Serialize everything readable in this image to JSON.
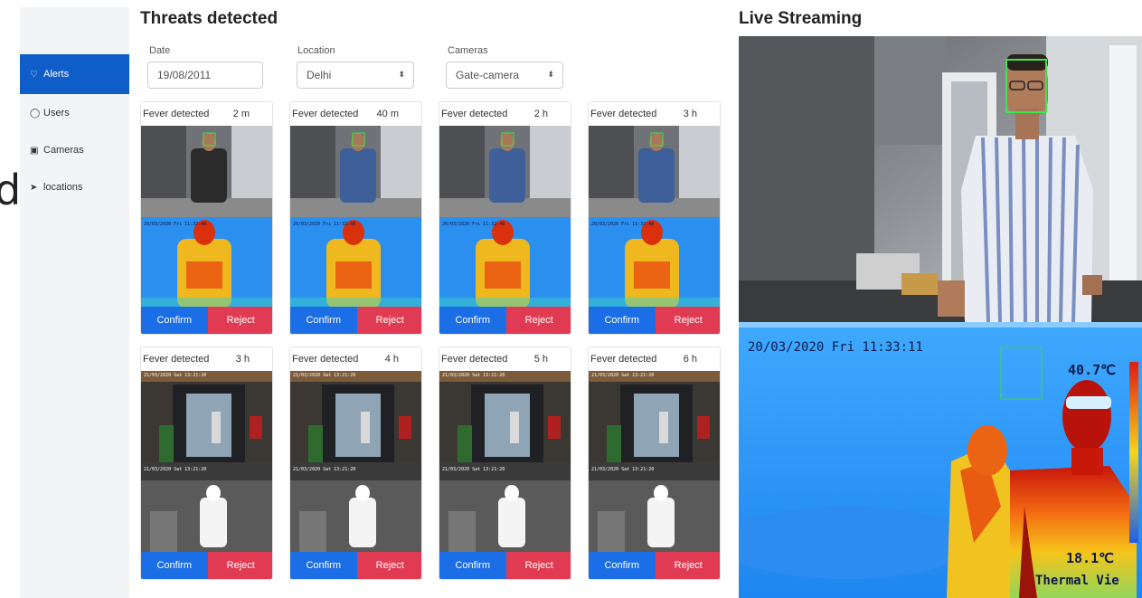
{
  "sidebar": {
    "items": [
      {
        "label": "Alerts",
        "icon": "bell-icon",
        "active": true
      },
      {
        "label": "Users",
        "icon": "user-icon",
        "active": false
      },
      {
        "label": "Cameras",
        "icon": "camera-icon",
        "active": false
      },
      {
        "label": "locations",
        "icon": "location-arrow-icon",
        "active": false
      }
    ]
  },
  "threats": {
    "title": "Threats detected",
    "filters": {
      "date": {
        "label": "Date",
        "value": "19/08/2011"
      },
      "location": {
        "label": "Location",
        "value": "Delhi"
      },
      "cameras": {
        "label": "Cameras",
        "value": "Gate-camera"
      }
    },
    "cards": [
      {
        "status": "Fever detected",
        "time": "2 m",
        "confirm": "Confirm",
        "reject": "Reject",
        "style": "color"
      },
      {
        "status": "Fever detected",
        "time": "40 m",
        "confirm": "Confirm",
        "reject": "Reject",
        "style": "color"
      },
      {
        "status": "Fever detected",
        "time": "2 h",
        "confirm": "Confirm",
        "reject": "Reject",
        "style": "color"
      },
      {
        "status": "Fever detected",
        "time": "3 h",
        "confirm": "Confirm",
        "reject": "Reject",
        "style": "color"
      },
      {
        "status": "Fever detected",
        "time": "3 h",
        "confirm": "Confirm",
        "reject": "Reject",
        "style": "grey"
      },
      {
        "status": "Fever detected",
        "time": "4 h",
        "confirm": "Confirm",
        "reject": "Reject",
        "style": "grey"
      },
      {
        "status": "Fever detected",
        "time": "5 h",
        "confirm": "Confirm",
        "reject": "Reject",
        "style": "grey"
      },
      {
        "status": "Fever detected",
        "time": "6 h",
        "confirm": "Confirm",
        "reject": "Reject",
        "style": "grey"
      }
    ]
  },
  "live": {
    "title": "Live Streaming",
    "thermal_timestamp": "20/03/2020 Fri 11:33:11",
    "temp_high": "40.7℃",
    "temp_low": "18.1℃",
    "thermal_label": "Thermal Vie"
  },
  "colors": {
    "accent": "#0f5dc9",
    "confirm": "#1c6ee6",
    "reject": "#e03b52"
  }
}
